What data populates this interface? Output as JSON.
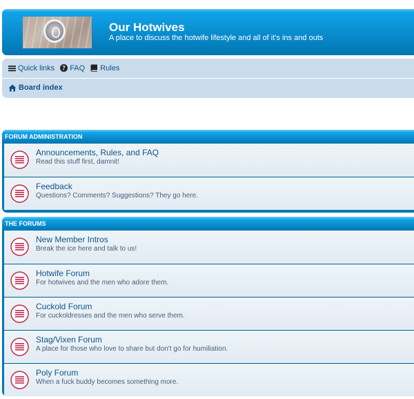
{
  "site": {
    "title": "Our Hotwives",
    "description": "A place to discuss the hotwife lifestyle and all of it's ins and outs"
  },
  "nav": {
    "quick_links": "Quick links",
    "faq": "FAQ",
    "rules": "Rules",
    "board_index": "Board index"
  },
  "categories": [
    {
      "name": "Forum Administration",
      "forums": [
        {
          "title": "Announcements, Rules, and FAQ",
          "desc": "Read this stuff first, damnit!"
        },
        {
          "title": "Feedback",
          "desc": "Questions? Comments? Suggestions? They go here."
        }
      ]
    },
    {
      "name": "The Forums",
      "forums": [
        {
          "title": "New Member Intros",
          "desc": "Break the ice here and talk to us!"
        },
        {
          "title": "Hotwife Forum",
          "desc": "For hotwives and the men who adore them."
        },
        {
          "title": "Cuckold Forum",
          "desc": "For cuckoldresses and the men who serve them."
        },
        {
          "title": "Stag/Vixen Forum",
          "desc": "A place for those who love to share but don't go for humiliation."
        },
        {
          "title": "Poly Forum",
          "desc": "When a fuck buddy becomes something more."
        }
      ]
    }
  ],
  "colors": {
    "header": "#0076b1",
    "link": "#105289",
    "navbar": "#cadceb",
    "forum_icon": "#c02a4a"
  },
  "icons": {
    "quick_links": "bars-icon",
    "faq": "question-circle-icon",
    "rules": "book-icon",
    "board_index": "home-icon",
    "forum": "forum-read-icon"
  }
}
